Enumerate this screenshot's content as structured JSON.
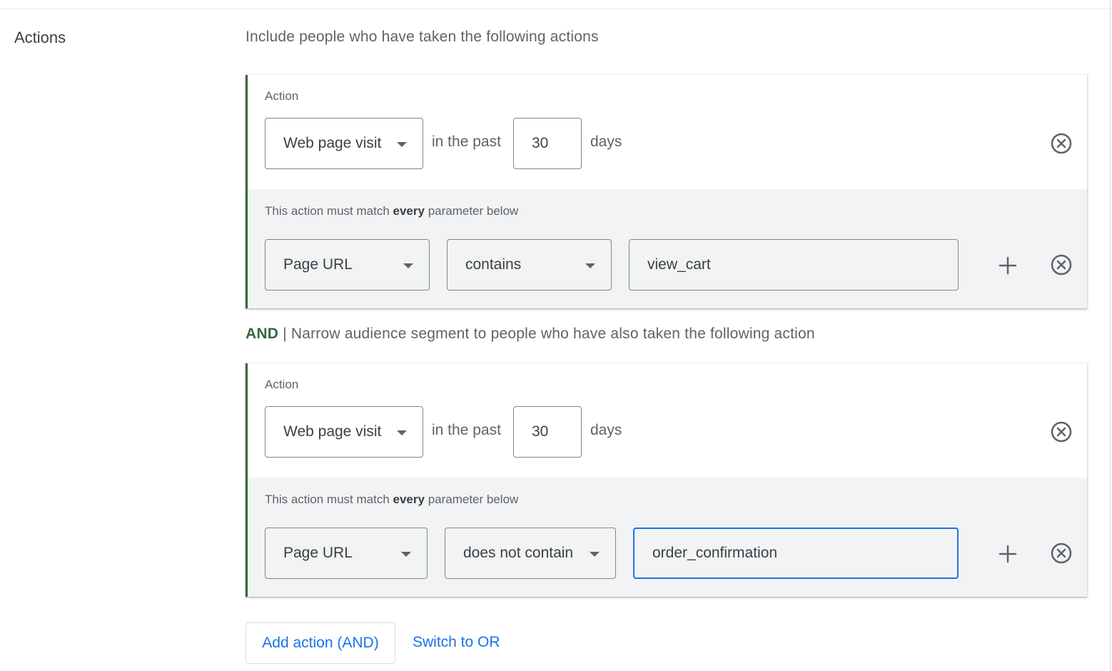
{
  "section": {
    "label": "Actions",
    "description": "Include people who have taken the following actions"
  },
  "and_connector": {
    "and_word": "AND",
    "separator": "|",
    "text": "Narrow audience segment to people who have also taken the following action"
  },
  "actions": [
    {
      "label": "Action",
      "type": "Web page visit",
      "in_the_past": "in the past",
      "days_value": "30",
      "days_label": "days",
      "params_note_prefix": "This action must match",
      "params_note_bold": "every",
      "params_note_suffix": "parameter below",
      "param": {
        "field": "Page URL",
        "operator": "contains",
        "value": "view_cart"
      }
    },
    {
      "label": "Action",
      "type": "Web page visit",
      "in_the_past": "in the past",
      "days_value": "30",
      "days_label": "days",
      "params_note_prefix": "This action must match",
      "params_note_bold": "every",
      "params_note_suffix": "parameter below",
      "param": {
        "field": "Page URL",
        "operator": "does not contain",
        "value": "order_confirmation"
      }
    }
  ],
  "buttons": {
    "add_action": "Add action (AND)",
    "switch_or": "Switch to OR"
  },
  "icons": {
    "remove": "close-circle-icon",
    "add": "plus-icon",
    "dropdown": "caret-down-icon"
  },
  "colors": {
    "accent_green": "#34693f",
    "link_blue": "#1a73e8",
    "param_bg": "#f1f3f4"
  }
}
